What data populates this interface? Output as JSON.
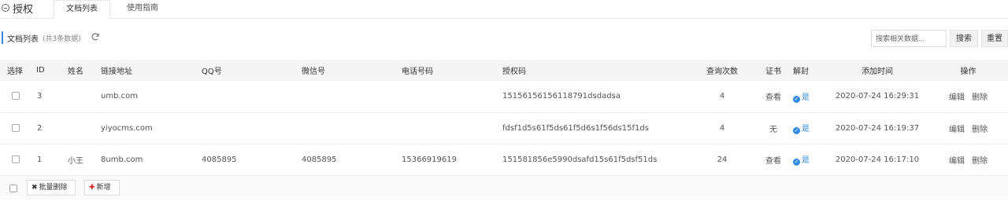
{
  "header": {
    "title": "授权",
    "tabs": [
      {
        "label": "文档列表",
        "active": true
      },
      {
        "label": "使用指南",
        "active": false
      }
    ]
  },
  "panel": {
    "title": "文档列表",
    "count_text": "(共3条数据)",
    "search_placeholder": "搜索相关数据...",
    "search_button": "搜索",
    "reset_button": "重置"
  },
  "table": {
    "columns": [
      "选择",
      "ID",
      "姓名",
      "链接地址",
      "QQ号",
      "微信号",
      "电话号码",
      "授权码",
      "查询次数",
      "证书",
      "解封",
      "添加时间",
      "操作"
    ],
    "rows": [
      {
        "id": "3",
        "name": "",
        "url": "umb.com",
        "qq": "",
        "wechat": "",
        "phone": "",
        "auth_code": "15156156156118791dsdadsa",
        "queries": "4",
        "cert": "查看",
        "cert_link": true,
        "unblock": "是",
        "added": "2020-07-24 16:29:31",
        "edit": "编辑",
        "delete": "删除"
      },
      {
        "id": "2",
        "name": "",
        "url": "yiyocms.com",
        "qq": "",
        "wechat": "",
        "phone": "",
        "auth_code": "fdsf1d5s61f5ds61f5d6s1f56ds15f1ds",
        "queries": "4",
        "cert": "无",
        "cert_link": false,
        "unblock": "是",
        "added": "2020-07-24 16:19:37",
        "edit": "编辑",
        "delete": "删除"
      },
      {
        "id": "1",
        "name": "小王",
        "url": "8umb.com",
        "qq": "4085895",
        "wechat": "4085895",
        "phone": "15366919619",
        "auth_code": "151581856e5990dsafd15s61f5dsf51ds",
        "queries": "24",
        "cert": "查看",
        "cert_link": true,
        "unblock": "是",
        "added": "2020-07-24 16:17:10",
        "edit": "编辑",
        "delete": "删除"
      }
    ]
  },
  "footer": {
    "batch_delete": "批量删除",
    "add_new": "新增"
  },
  "colors": {
    "accent": "#2d8cf0",
    "link": "#2b6cb0",
    "danger": "#e02020"
  }
}
